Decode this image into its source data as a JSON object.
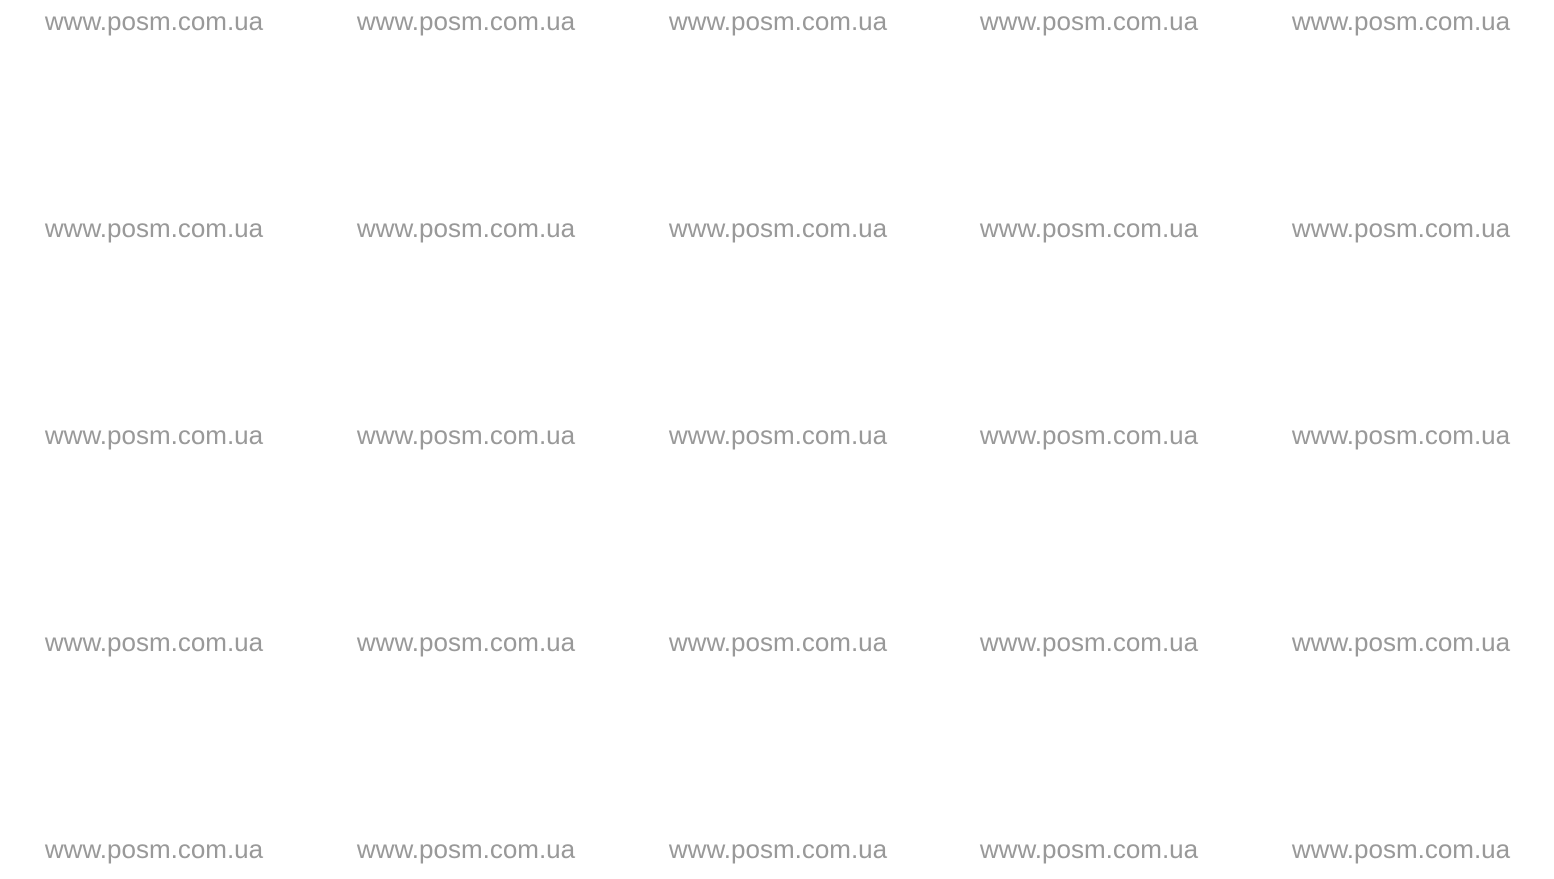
{
  "watermark": {
    "text": "www.posm.com.ua",
    "color": "#999999",
    "background": "#ffffff"
  }
}
